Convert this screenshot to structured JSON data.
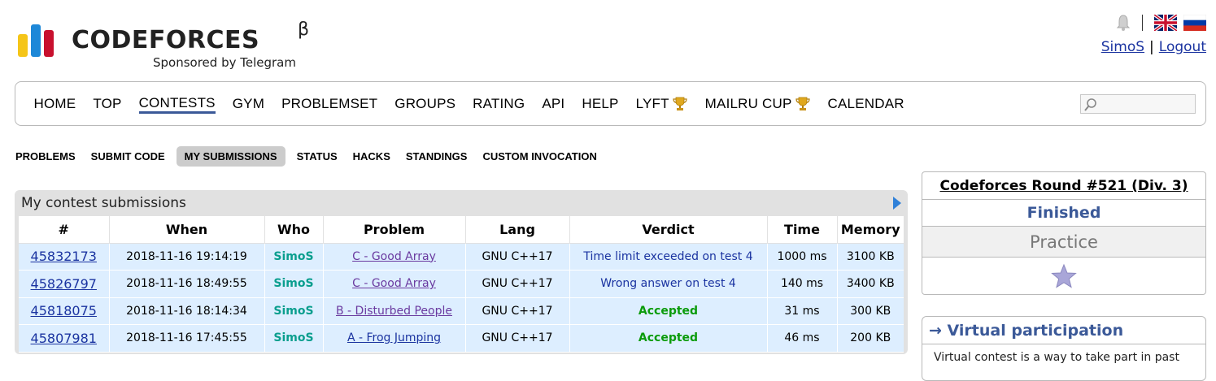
{
  "header": {
    "logo_word": "CODEFORCES",
    "logo_beta": "β",
    "sponsor": "Sponsored by Telegram",
    "user": "SimoS",
    "separator": "|",
    "logout": "Logout",
    "lang_separator": "|",
    "colors": {
      "logo_yellow": "#f5c518",
      "logo_blue": "#1e88d8",
      "logo_red": "#c8102e"
    }
  },
  "menu": {
    "items": [
      {
        "label": "HOME",
        "active": false,
        "trophy": false
      },
      {
        "label": "TOP",
        "active": false,
        "trophy": false
      },
      {
        "label": "CONTESTS",
        "active": true,
        "trophy": false
      },
      {
        "label": "GYM",
        "active": false,
        "trophy": false
      },
      {
        "label": "PROBLEMSET",
        "active": false,
        "trophy": false
      },
      {
        "label": "GROUPS",
        "active": false,
        "trophy": false
      },
      {
        "label": "RATING",
        "active": false,
        "trophy": false
      },
      {
        "label": "API",
        "active": false,
        "trophy": false
      },
      {
        "label": "HELP",
        "active": false,
        "trophy": false
      },
      {
        "label": "LYFT",
        "active": false,
        "trophy": true
      },
      {
        "label": "MAILRU CUP",
        "active": false,
        "trophy": true
      },
      {
        "label": "CALENDAR",
        "active": false,
        "trophy": false
      }
    ],
    "search": {
      "value": "",
      "placeholder": ""
    }
  },
  "second_menu": {
    "items": [
      {
        "label": "PROBLEMS",
        "selected": false
      },
      {
        "label": "SUBMIT CODE",
        "selected": false
      },
      {
        "label": "MY SUBMISSIONS",
        "selected": true
      },
      {
        "label": "STATUS",
        "selected": false
      },
      {
        "label": "HACKS",
        "selected": false
      },
      {
        "label": "STANDINGS",
        "selected": false
      },
      {
        "label": "CUSTOM INVOCATION",
        "selected": false
      }
    ]
  },
  "submissions": {
    "caption": "My contest submissions",
    "columns": [
      "#",
      "When",
      "Who",
      "Problem",
      "Lang",
      "Verdict",
      "Time",
      "Memory"
    ],
    "rows": [
      {
        "id": "45832173",
        "when": "2018-11-16 19:14:19",
        "who": "SimoS",
        "problem": "C - Good Array",
        "lang": "GNU C++17",
        "verdict": "Time limit exceeded on test 4",
        "accepted": false,
        "time": "1000 ms",
        "memory": "3100 KB"
      },
      {
        "id": "45826797",
        "when": "2018-11-16 18:49:55",
        "who": "SimoS",
        "problem": "C - Good Array",
        "lang": "GNU C++17",
        "verdict": "Wrong answer on test 4",
        "accepted": false,
        "time": "140 ms",
        "memory": "3400 KB"
      },
      {
        "id": "45818075",
        "when": "2018-11-16 18:14:34",
        "who": "SimoS",
        "problem": "B - Disturbed People",
        "lang": "GNU C++17",
        "verdict": "Accepted",
        "accepted": true,
        "time": "31 ms",
        "memory": "300 KB"
      },
      {
        "id": "45807981",
        "when": "2018-11-16 17:45:55",
        "who": "SimoS",
        "problem": "A - Frog Jumping",
        "lang": "GNU C++17",
        "verdict": "Accepted",
        "accepted": true,
        "time": "46 ms",
        "memory": "200 KB"
      }
    ]
  },
  "sidebar": {
    "contest_name": "Codeforces Round #521 (Div. 3)",
    "phase": "Finished",
    "practice": "Practice",
    "virtual_title": "→ Virtual participation",
    "virtual_text": "Virtual contest is a way to take part in past"
  }
}
